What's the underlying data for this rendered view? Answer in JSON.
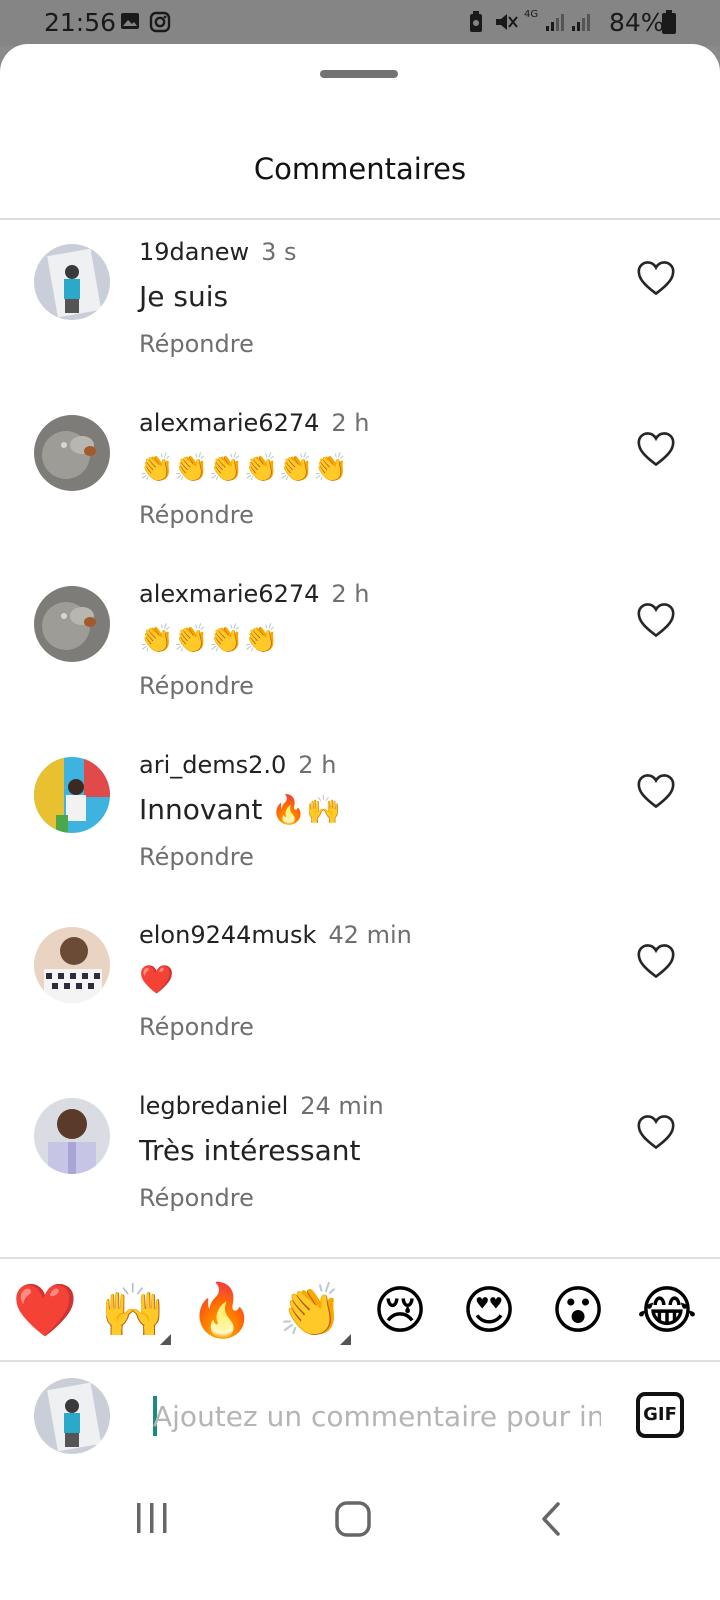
{
  "status_bar": {
    "time": "21:56",
    "battery": "84%",
    "network": "4G"
  },
  "sheet": {
    "title": "Commentaires"
  },
  "comments": [
    {
      "user": "19danew",
      "time": "3 s",
      "text": "Je suis",
      "reply": "Répondre"
    },
    {
      "user": "alexmarie6274",
      "time": "2 h",
      "text": "👏👏👏👏👏👏",
      "reply": "Répondre"
    },
    {
      "user": "alexmarie6274",
      "time": "2 h",
      "text": "👏👏👏👏",
      "reply": "Répondre"
    },
    {
      "user": "ari_dems2.0",
      "time": "2 h",
      "text": "Innovant 🔥🙌",
      "reply": "Répondre"
    },
    {
      "user": "elon9244musk",
      "time": "42 min",
      "text": "❤️",
      "reply": "Répondre"
    },
    {
      "user": "legbredaniel",
      "time": "24 min",
      "text": "Très intéressant",
      "reply": "Répondre"
    }
  ],
  "emoji_bar": [
    "❤️",
    "🙌",
    "🔥",
    "👏",
    "😢",
    "😍",
    "😮",
    "😂"
  ],
  "composer": {
    "placeholder": "Ajoutez un commentaire pour in_r",
    "gif_label": "GIF"
  },
  "colors": {
    "accent_caret": "#1e8a7a",
    "secondary_text": "#6f6f6f",
    "like_outline": "#262626"
  }
}
